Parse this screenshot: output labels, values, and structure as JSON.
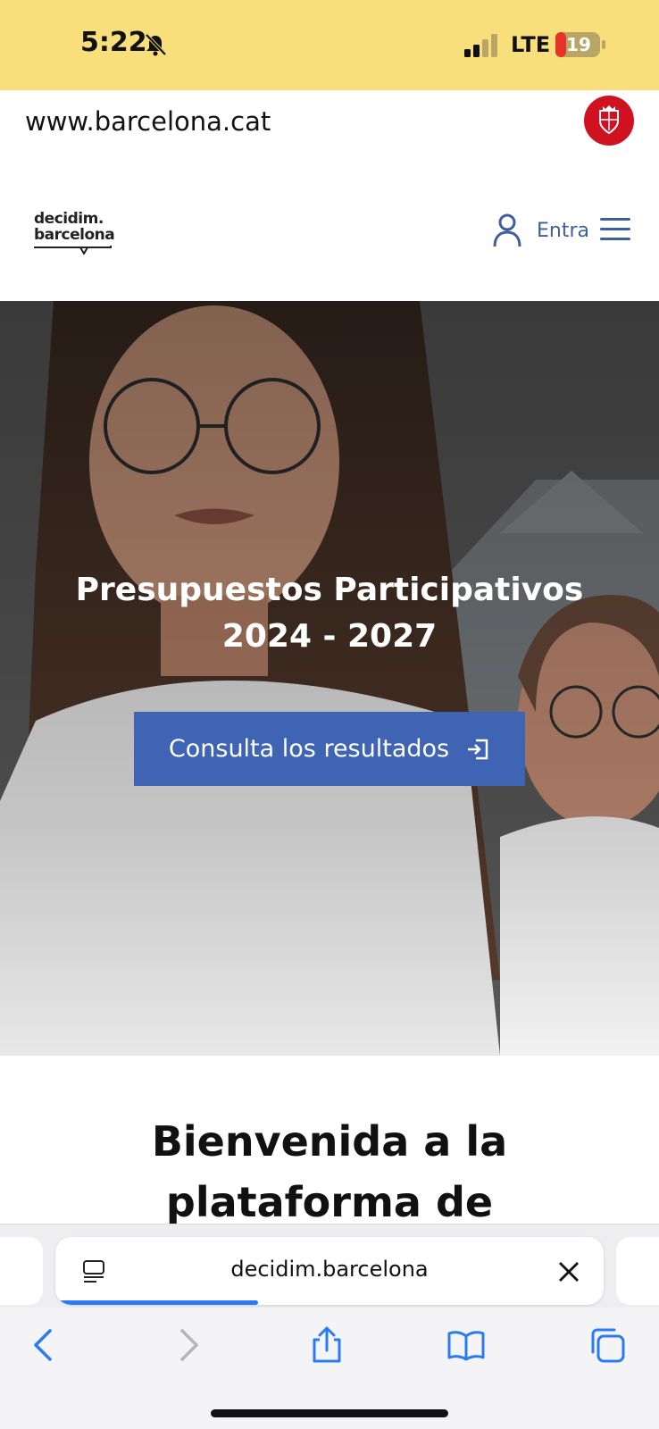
{
  "status_bar": {
    "time": "5:22",
    "network": "LTE",
    "battery": "19",
    "background_color": "#f9df7b"
  },
  "domain_bar": {
    "domain": "www.barcelona.cat",
    "seal_color": "#d0111f"
  },
  "header": {
    "logo_line1": "decidim.",
    "logo_line2": "barcelona",
    "login_label": "Entra",
    "accent_color": "#3e5f9e"
  },
  "hero": {
    "title": "Presupuestos Participativos 2024 - 2027",
    "button_label": "Consulta los resultados",
    "button_color": "#3f64b3"
  },
  "welcome": {
    "title": "Bienvenida a la plataforma de participación ciudadana"
  },
  "browser": {
    "url": "decidim.barcelona",
    "load_progress": 0.37,
    "progress_color": "#2a7bf2"
  },
  "icons": {
    "status": [
      "bell-slash-icon",
      "signal-icon",
      "battery-icon"
    ],
    "header": [
      "user-icon",
      "menu-icon"
    ],
    "toolbar": [
      "back-icon",
      "forward-icon",
      "share-icon",
      "bookmarks-icon",
      "tabs-icon"
    ]
  }
}
